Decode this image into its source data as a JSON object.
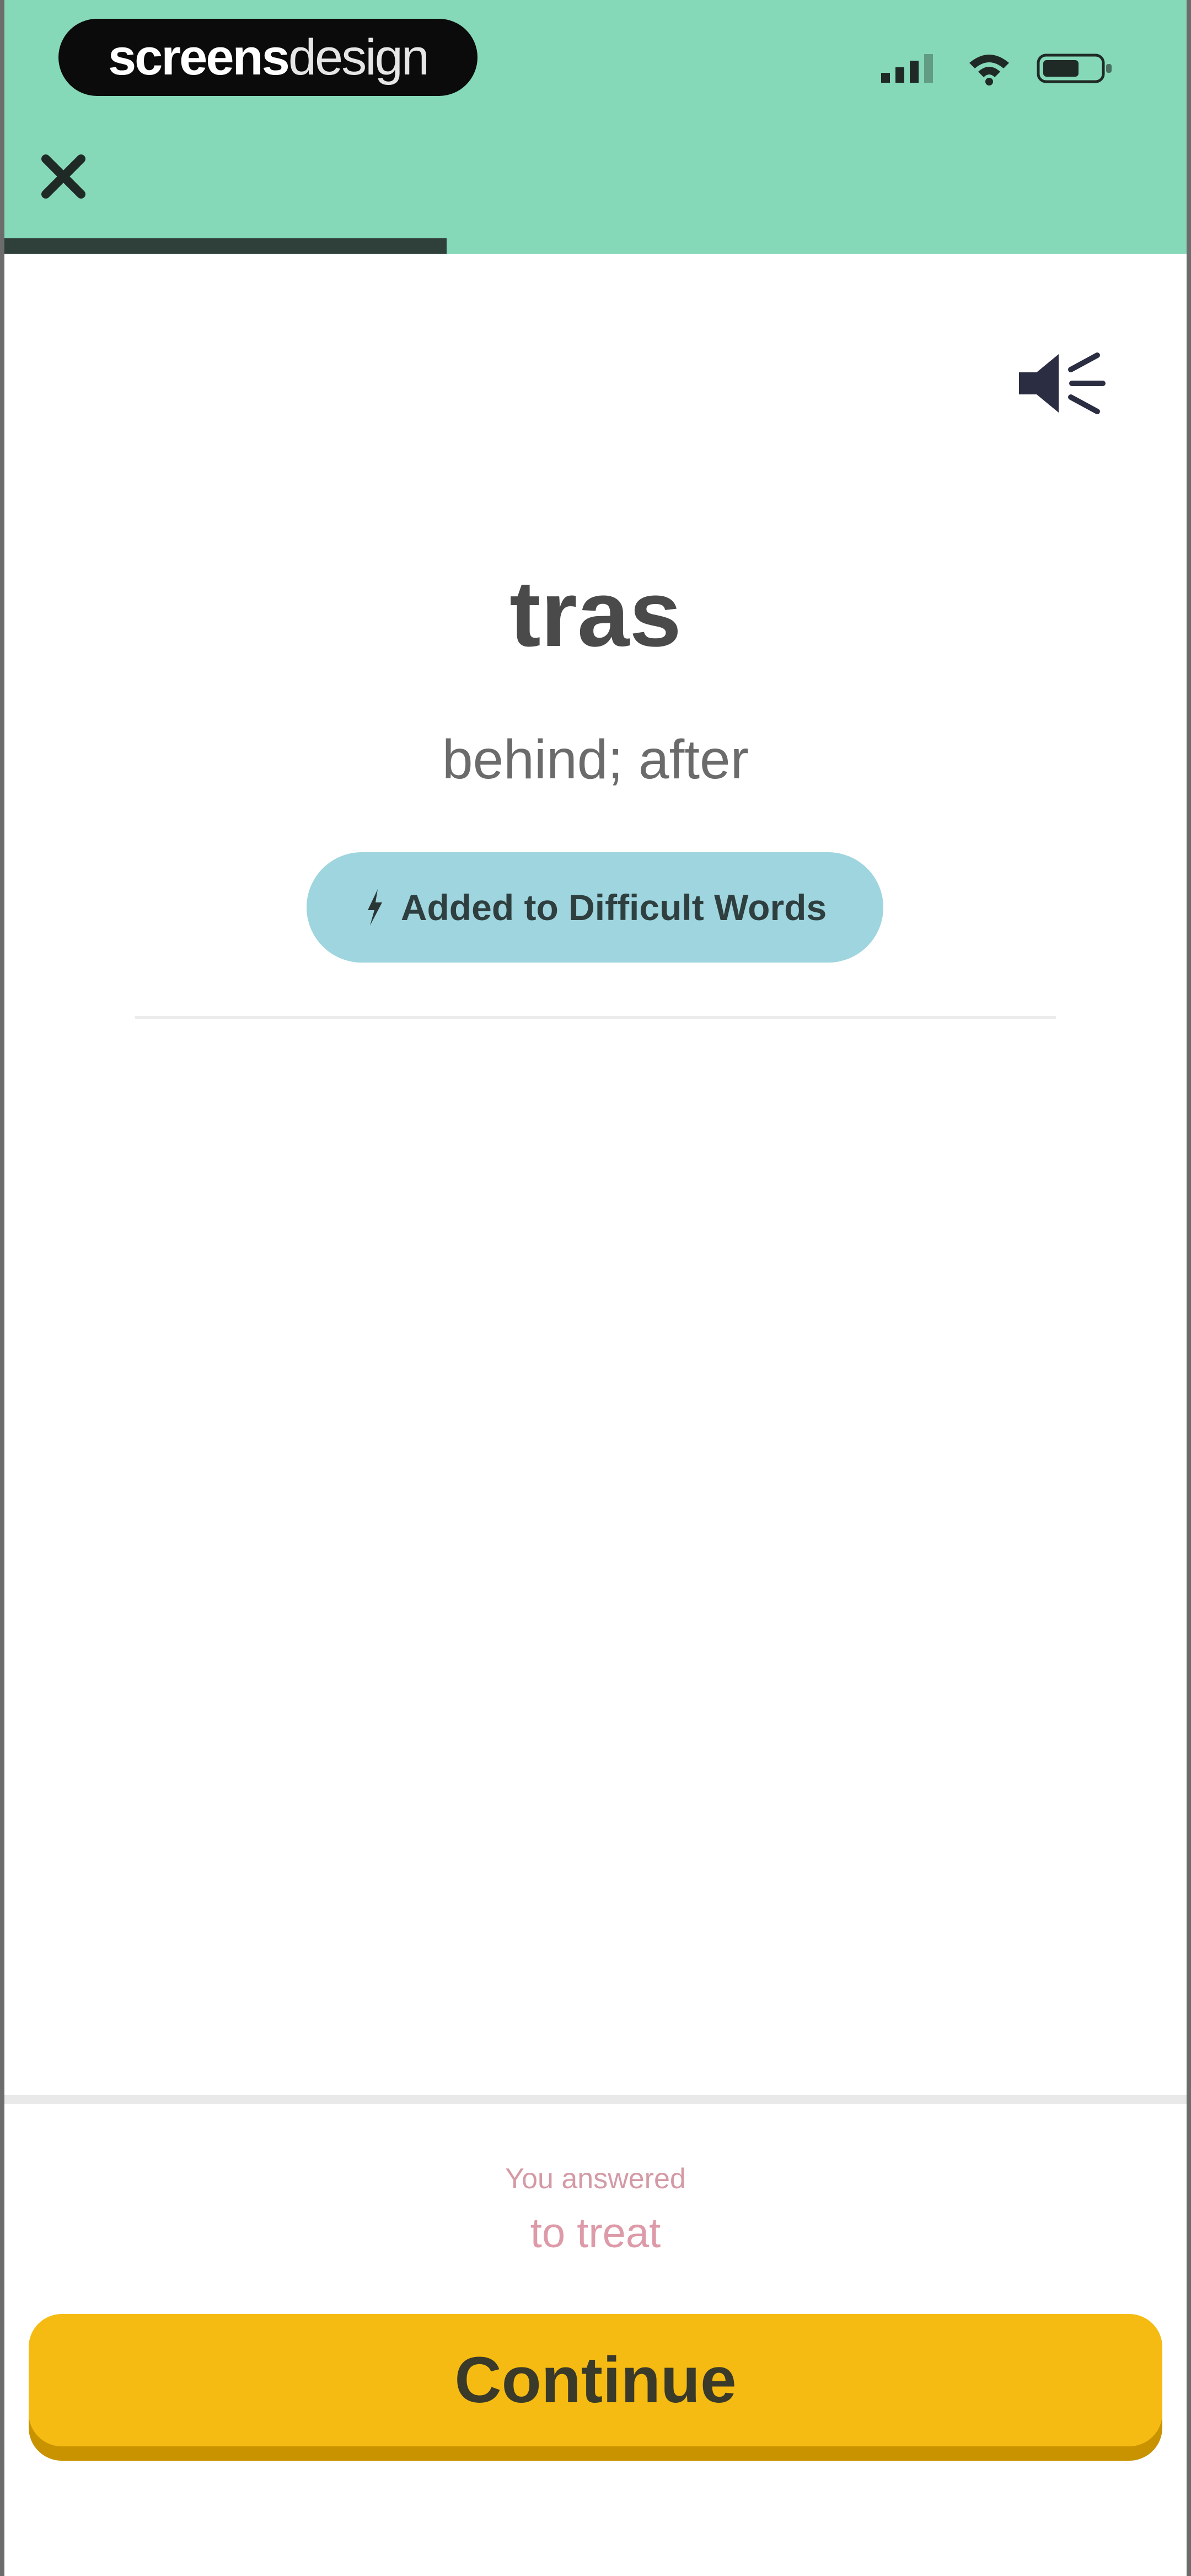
{
  "watermark": {
    "bold": "screens",
    "light": "design"
  },
  "status_bar": {
    "signal": "signal-icon",
    "wifi": "wifi-icon",
    "battery": "battery-icon"
  },
  "header": {
    "close_icon": "close-icon"
  },
  "progress": {
    "fraction": 0.375
  },
  "card": {
    "speaker_icon": "speaker-icon",
    "word": "tras",
    "meaning": "behind; after",
    "difficult_label": "Added to Difficult Words",
    "bolt_icon": "lightning-icon"
  },
  "feedback": {
    "label": "You answered",
    "value": "to treat"
  },
  "actions": {
    "continue_label": "Continue"
  },
  "colors": {
    "header_bg": "#86d9b8",
    "pill_bg": "#9ed5df",
    "continue_bg": "#f5bb12",
    "answer_text": "#dd9aa8"
  }
}
